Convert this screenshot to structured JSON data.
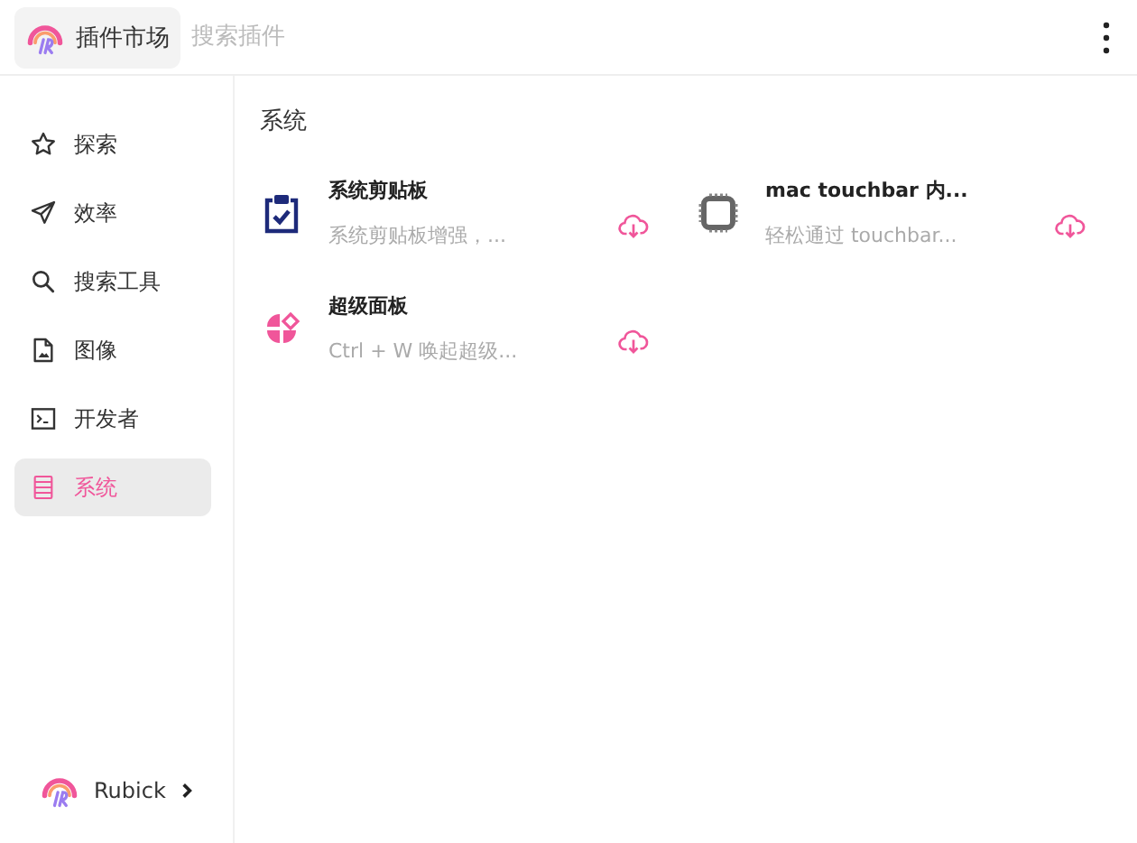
{
  "header": {
    "title": "插件市场",
    "search": {
      "placeholder": "搜索插件"
    }
  },
  "sidebar": {
    "items": [
      {
        "label": "探索",
        "kind": "star",
        "selected": false
      },
      {
        "label": "效率",
        "kind": "send",
        "selected": false
      },
      {
        "label": "搜索工具",
        "kind": "search",
        "selected": false
      },
      {
        "label": "图像",
        "kind": "image",
        "selected": false
      },
      {
        "label": "开发者",
        "kind": "terminal",
        "selected": false
      },
      {
        "label": "系统",
        "kind": "list",
        "selected": true
      }
    ],
    "footer": {
      "label": "Rubick"
    }
  },
  "section": {
    "title": "系统",
    "plugins": [
      {
        "name": "系统剪贴板",
        "description": "系统剪贴板增强，...",
        "kind": "clipboard"
      },
      {
        "name": "mac touchbar 内...",
        "description": "轻松通过 touchbar...",
        "kind": "chip"
      },
      {
        "name": "超级面板",
        "description": "Ctrl + W 唤起超级...",
        "kind": "clover"
      }
    ]
  }
}
